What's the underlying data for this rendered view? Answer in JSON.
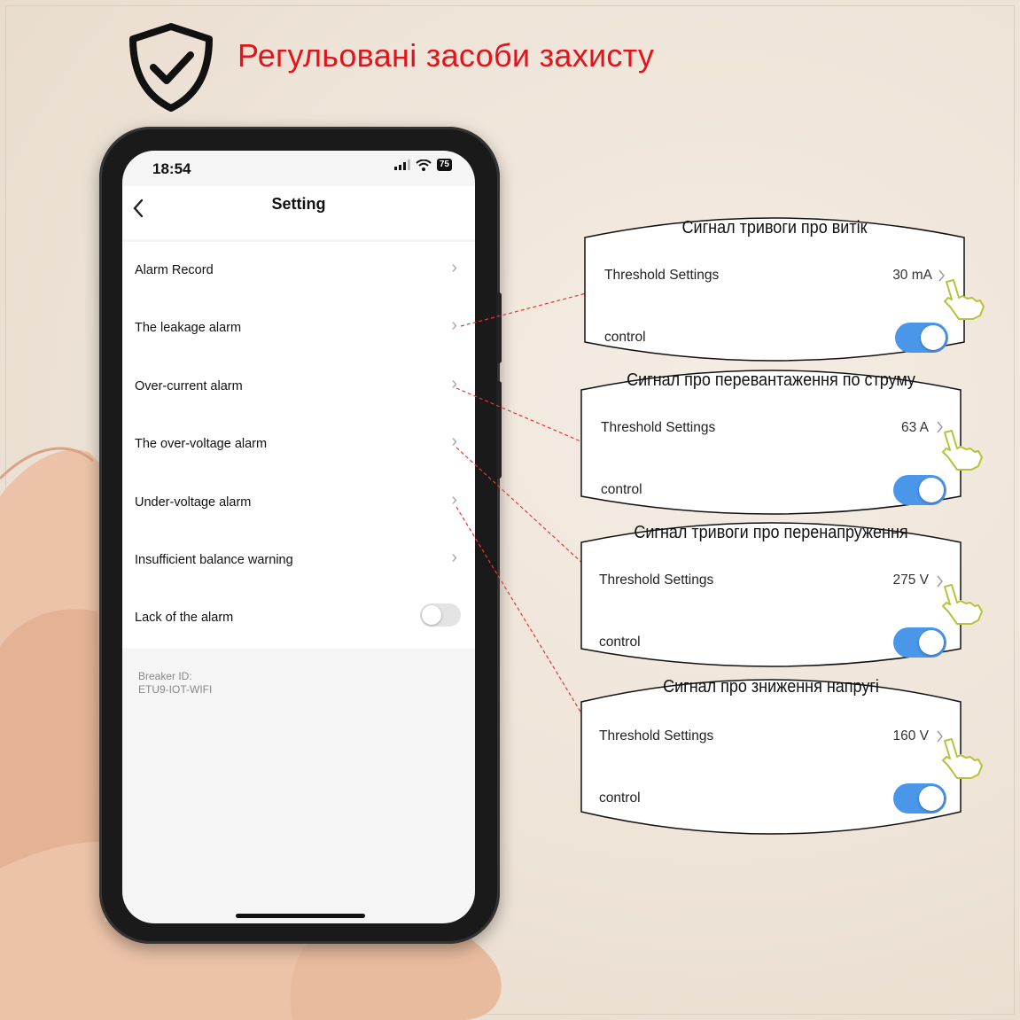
{
  "headline": "Регульовані засоби захисту",
  "phone": {
    "status": {
      "time": "18:54",
      "battery": "75"
    },
    "nav": {
      "back_icon": "chevron-left-icon",
      "title": "Setting"
    },
    "items": [
      {
        "label": "Alarm Record",
        "control": "chevron"
      },
      {
        "label": "The leakage alarm",
        "control": "chevron"
      },
      {
        "label": "Over-current alarm",
        "control": "chevron"
      },
      {
        "label": "The over-voltage alarm",
        "control": "chevron"
      },
      {
        "label": "Under-voltage alarm",
        "control": "chevron"
      },
      {
        "label": "Insufficient balance warning",
        "control": "chevron"
      },
      {
        "label": "Lack of the alarm",
        "control": "toggle",
        "on": false
      }
    ],
    "breaker_id_label": "Breaker ID:",
    "breaker_id_value": "ETU9-IOT-WIFI"
  },
  "callouts": [
    {
      "title": "Сигнал тривоги про витік",
      "threshold_label": "Threshold Settings",
      "value": "30 mA",
      "control_label": "control",
      "control_on": true
    },
    {
      "title": "Сигнал про перевантаження по струму",
      "threshold_label": "Threshold Settings",
      "value": "63 A",
      "control_label": "control",
      "control_on": true
    },
    {
      "title": "Сигнал тривоги про перенапруження",
      "threshold_label": "Threshold Settings",
      "value": "275 V",
      "control_label": "control",
      "control_on": true
    },
    {
      "title": "Сигнал про зниження напругі",
      "threshold_label": "Threshold Settings",
      "value": "160 V",
      "control_label": "control",
      "control_on": true
    }
  ],
  "colors": {
    "headline": "#e0141a",
    "toggle_on": "#4a96e8",
    "pointer_hand": "#b7c23a",
    "connector": "#e03a3a"
  }
}
